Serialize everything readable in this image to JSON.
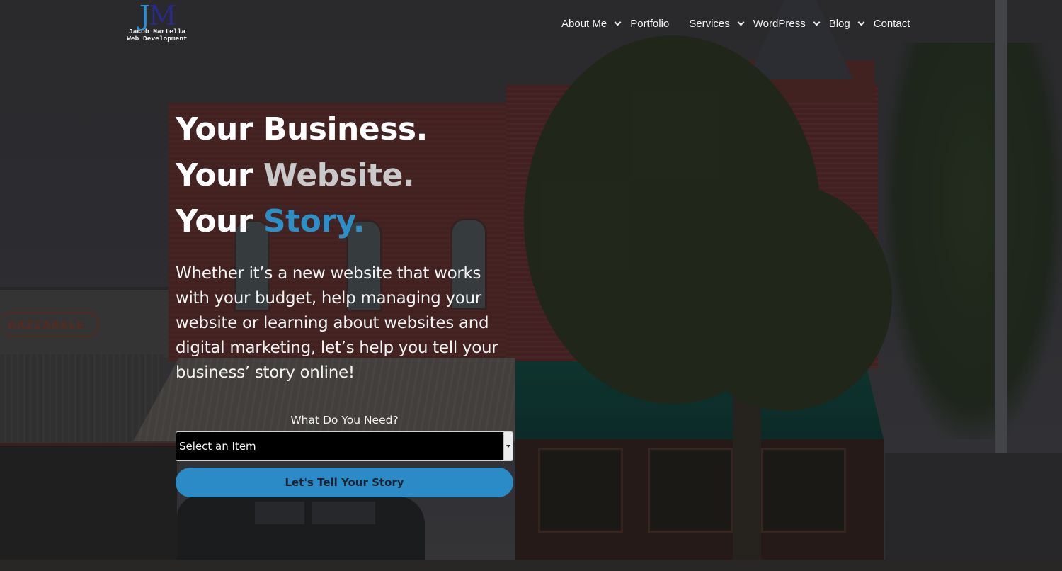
{
  "header": {
    "logo": {
      "mark_j": "J",
      "mark_m": "M",
      "line1": "Jacob Martella",
      "line2": "Web Development",
      "colors": {
        "j": "#2d8fd4",
        "m": "#2a2a8a"
      }
    },
    "nav": [
      {
        "label": "About Me",
        "has_dropdown": true
      },
      {
        "label": "Portfolio",
        "has_dropdown": false
      },
      {
        "label": "Services",
        "has_dropdown": true
      },
      {
        "label": "WordPress",
        "has_dropdown": true
      },
      {
        "label": "Blog",
        "has_dropdown": true
      },
      {
        "label": "Contact",
        "has_dropdown": false
      }
    ]
  },
  "hero": {
    "headline": [
      {
        "prefix": "Your",
        "word": "Business.",
        "word_color": "#ffffff"
      },
      {
        "prefix": "Your",
        "word": "Website.",
        "word_color": "#c9c9c9"
      },
      {
        "prefix": "Your",
        "word": "Story.",
        "word_color": "#2d8fc7"
      }
    ],
    "intro_lines": [
      "Whether it’s a new website that works",
      "with your budget, help managing your",
      "website or learning about websites and",
      "digital marketing, let’s help you tell your",
      "business’ story online!"
    ]
  },
  "form": {
    "label": "What Do You Need?",
    "select": {
      "selected": "Select an Item",
      "icon": "caret-down-icon"
    },
    "submit_label": "Let's Tell Your Story",
    "accent_color": "#2a8bc6"
  },
  "background": {
    "sign_text": "DAZZARKLE"
  }
}
